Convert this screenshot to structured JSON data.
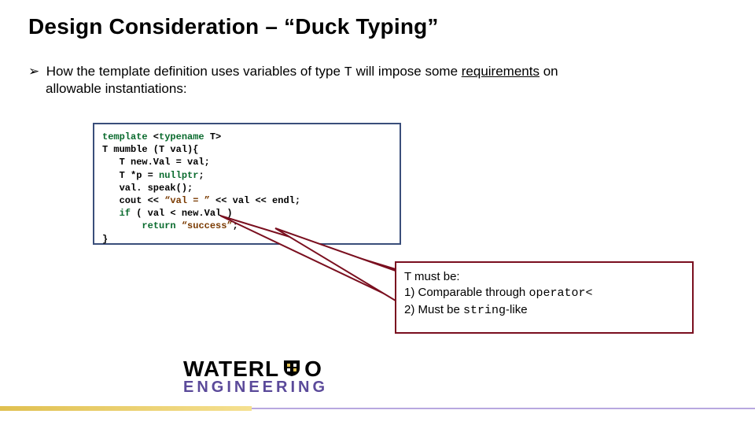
{
  "title": "Design Consideration – “Duck Typing”",
  "bullet": {
    "marker": "➢",
    "pre": "How the template definition uses variables of type ",
    "T": "T",
    "mid": " will impose some ",
    "req": "requirements",
    "post": " on",
    "line2": "allowable instantiations:"
  },
  "code": {
    "l1a": "template",
    "l1b": " <",
    "l1c": "typename",
    "l1d": " T>",
    "l2": "T mumble (T val){",
    "l3": "   T new.Val = val;",
    "l4a": "   T *p = ",
    "l4b": "nullptr",
    "l4c": ";",
    "l5": "   val. speak();",
    "l6a": "   cout << ",
    "l6b": "“val = ”",
    "l6c": " << val << endl;",
    "l7a": "   ",
    "l7b": "if",
    "l7c": " ( val < new.Val )",
    "l8a": "       ",
    "l8b": "return",
    "l8c": " ",
    "l8d": "“success”",
    "l8e": ";",
    "l9": "}"
  },
  "callout": {
    "l1": "T must be:",
    "l2a": "1) Comparable through ",
    "l2b": "operator<",
    "l3a": "2) Must be ",
    "l3b": "string",
    "l3c": "-like"
  },
  "logo": {
    "top_left": "WATERL",
    "top_right": "O",
    "bottom": "ENGINEERING"
  }
}
